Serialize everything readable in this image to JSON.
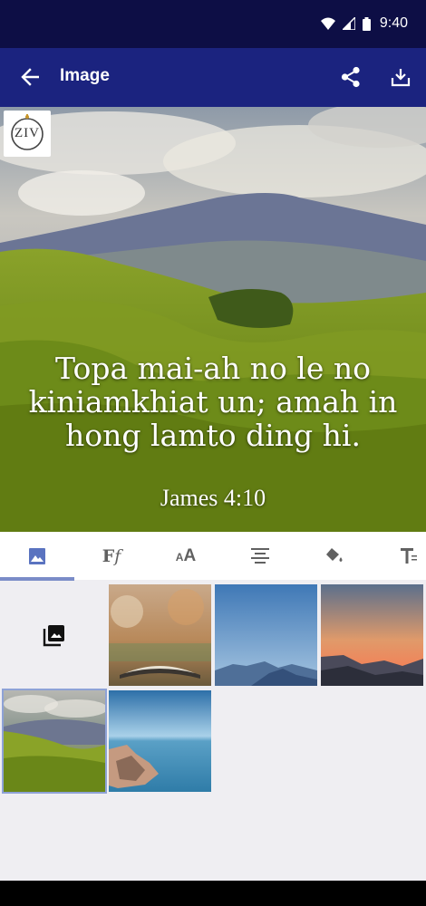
{
  "status_bar": {
    "time": "9:40",
    "icons": [
      "wifi-icon",
      "cell-signal-icon",
      "battery-icon"
    ]
  },
  "app_bar": {
    "title": "Image",
    "back_icon": "arrow-back-icon",
    "actions": [
      "share-icon",
      "download-icon"
    ]
  },
  "preview": {
    "logo_text": "ZIV",
    "verse": "Topa mai-ah no le no kiniamkhiat un; amah in hong lamto ding hi.",
    "reference": "James 4:10"
  },
  "tabs": {
    "items": [
      {
        "icon": "image-icon",
        "active": true
      },
      {
        "icon": "font-family-icon",
        "glyph": "F",
        "glyph2": "f"
      },
      {
        "icon": "font-size-icon",
        "glyph_small": "A",
        "glyph": "A"
      },
      {
        "icon": "align-center-icon"
      },
      {
        "icon": "paint-bucket-icon"
      },
      {
        "icon": "text-format-icon"
      }
    ],
    "active_color": "#7a8cc8"
  },
  "gallery": {
    "picker_icon": "photo-library-icon",
    "thumbnails": [
      {
        "name": "open-book-bokeh",
        "selected": false
      },
      {
        "name": "blue-mountains",
        "selected": false
      },
      {
        "name": "sunset-mountains",
        "selected": false
      },
      {
        "name": "tea-plantation-hills",
        "selected": true
      },
      {
        "name": "lake-rocks",
        "selected": false
      }
    ]
  },
  "colors": {
    "status_bar": "#0d0e45",
    "app_bar": "#1b237f",
    "background": "#efeef2"
  }
}
